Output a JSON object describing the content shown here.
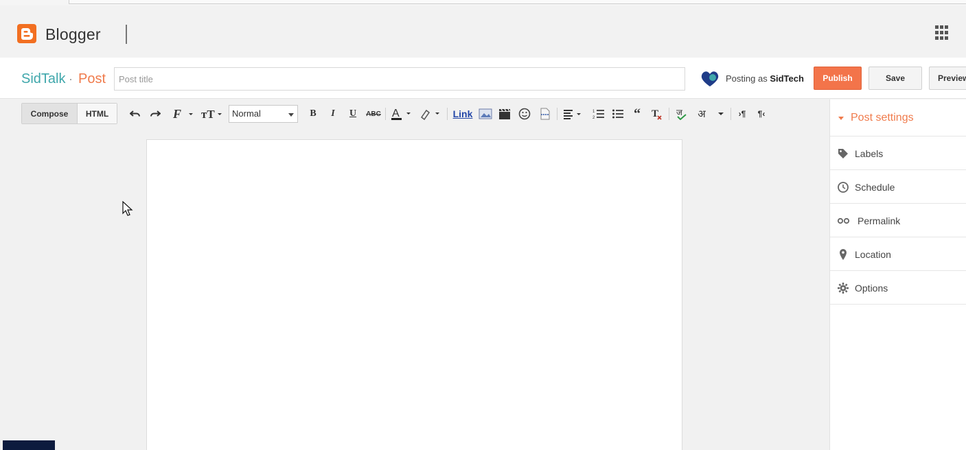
{
  "app": {
    "brand": "Blogger"
  },
  "post_bar": {
    "blog_name": "SidTalk",
    "separator": "·",
    "post_label": "Post",
    "title_placeholder": "Post title",
    "title_value": "",
    "posting_as_prefix": "Posting as",
    "posting_as_name": "SidTech",
    "publish_label": "Publish",
    "save_label": "Save",
    "preview_label": "Preview"
  },
  "toolbar": {
    "compose_label": "Compose",
    "html_label": "HTML",
    "font_size_selected": "Normal",
    "link_label": "Link",
    "icons": [
      "undo-icon",
      "redo-icon",
      "font-family-icon",
      "font-size-icon",
      "bold-icon",
      "italic-icon",
      "underline-icon",
      "strikethrough-icon",
      "text-color-icon",
      "highlight-icon",
      "image-icon",
      "video-icon",
      "emoji-icon",
      "jump-break-icon",
      "align-icon",
      "numbered-list-icon",
      "bulleted-list-icon",
      "quote-icon",
      "remove-formatting-icon",
      "spellcheck-icon",
      "transliteration-icon",
      "ltr-icon",
      "rtl-icon"
    ]
  },
  "sidebar": {
    "header": "Post settings",
    "items": [
      {
        "label": "Labels",
        "icon": "tag-icon"
      },
      {
        "label": "Schedule",
        "icon": "clock-icon"
      },
      {
        "label": "Permalink",
        "icon": "link-icon"
      },
      {
        "label": "Location",
        "icon": "pin-icon"
      },
      {
        "label": "Options",
        "icon": "gear-icon"
      }
    ]
  },
  "colors": {
    "accent_orange": "#f3744a",
    "blog_teal": "#3fa7ab",
    "logo_orange": "#f26f21"
  }
}
